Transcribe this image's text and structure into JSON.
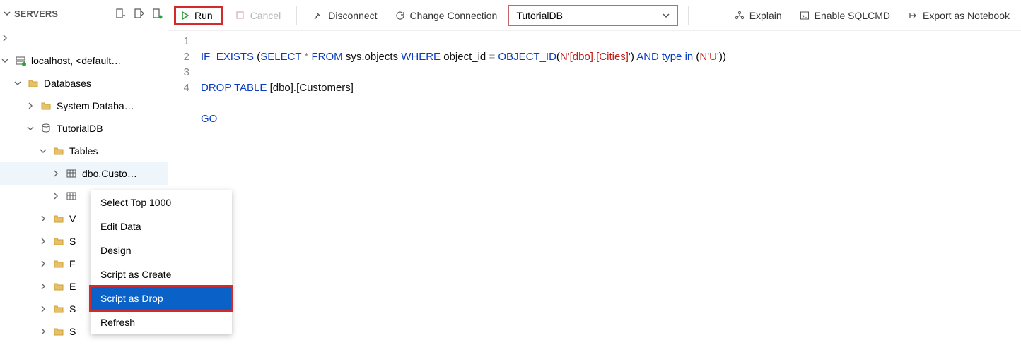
{
  "sidebar": {
    "title": "SERVERS",
    "nodes": {
      "server": "localhost, <default…",
      "databases": "Databases",
      "sysdb": "System Databa…",
      "tutorialdb": "TutorialDB",
      "tables": "Tables",
      "custo": "dbo.Custo…",
      "trunc": [
        "V",
        "S",
        "F",
        "E",
        "S",
        "S"
      ]
    }
  },
  "context_menu": {
    "items": [
      "Select Top 1000",
      "Edit Data",
      "Design",
      "Script as Create",
      "Script as Drop",
      "Refresh"
    ],
    "highlighted_index": 4
  },
  "toolbar": {
    "run": "Run",
    "cancel": "Cancel",
    "disconnect": "Disconnect",
    "change_conn": "Change Connection",
    "db": "TutorialDB",
    "explain": "Explain",
    "sqlcmd": "Enable SQLCMD",
    "notebook": "Export as Notebook"
  },
  "code": {
    "lines": [
      "1",
      "2",
      "3",
      "4"
    ],
    "l1": {
      "if": "IF",
      "exists": "EXISTS",
      "select": "SELECT",
      "star": "*",
      "from": "FROM",
      "sysobj": "sys.objects",
      "where": "WHERE",
      "objid": "object_id",
      "fnname": "OBJECT_ID",
      "str1": "N'[dbo].[Cities]'",
      "and": "AND",
      "type": "type",
      "in": "in",
      "str2": "N'U'"
    },
    "l2": {
      "drop": "DROP",
      "table": "TABLE",
      "tgt": "[dbo].[Customers]"
    },
    "l3": {
      "go": "GO"
    }
  }
}
